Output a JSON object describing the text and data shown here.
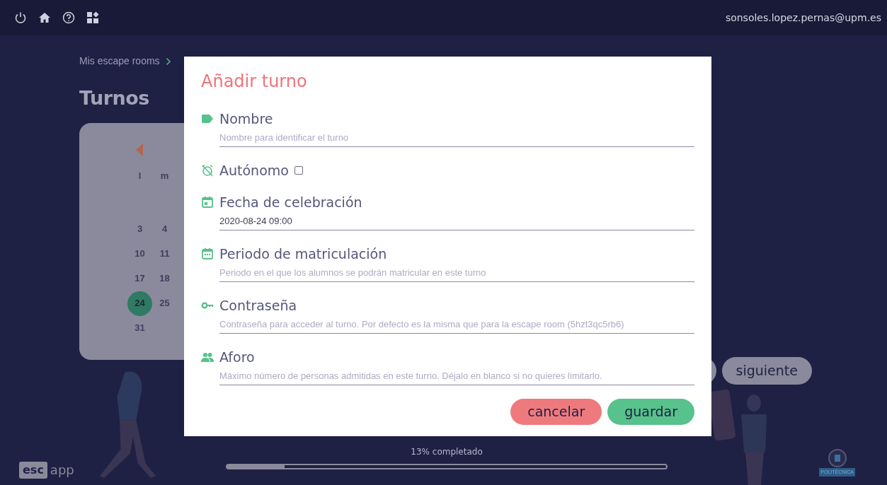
{
  "top_bar": {
    "user_email": "sonsoles.lopez.pernas@upm.es"
  },
  "breadcrumb": [
    {
      "label": "Mis escape rooms"
    }
  ],
  "page_title": "Turnos",
  "calendar": {
    "weekdays": [
      "l",
      "m"
    ],
    "weeks": [
      [
        {
          "day": "3",
          "selected": false
        },
        {
          "day": "4",
          "selected": false
        }
      ],
      [
        {
          "day": "10",
          "selected": false
        },
        {
          "day": "11",
          "selected": false
        }
      ],
      [
        {
          "day": "17",
          "selected": false
        },
        {
          "day": "18",
          "selected": false
        }
      ],
      [
        {
          "day": "24",
          "selected": true
        },
        {
          "day": "25",
          "selected": false
        }
      ],
      [
        {
          "day": "31",
          "selected": false
        }
      ]
    ]
  },
  "modal": {
    "title": "Añadir turno",
    "fields": [
      {
        "kind": "text",
        "label": "Nombre",
        "placeholder": "Nombre para identificar el turno"
      },
      {
        "kind": "checkbox",
        "label": "Autónomo",
        "checked": false
      },
      {
        "kind": "text",
        "label": "Fecha de celebración",
        "value": "2020-08-24 09:00"
      },
      {
        "kind": "text",
        "label": "Periodo de matriculación",
        "placeholder": "Periodo en el que los alumnos se podrán matricular en este turno"
      },
      {
        "kind": "text",
        "label": "Contraseña",
        "placeholder": "Contraseña para acceder al turno. Por defecto es la misma que para la escape room (5hzt3qc5rb6)"
      },
      {
        "kind": "text",
        "label": "Aforo",
        "placeholder": "Máximo número de personas admitidas en este turno. Déjalo en blanco si no quieres limitarlo."
      }
    ],
    "buttons": [
      {
        "kind": "cancel",
        "label": "cancelar"
      },
      {
        "kind": "save",
        "label": "guardar"
      }
    ]
  },
  "wizard": {
    "next_button": "siguiente"
  },
  "progress": {
    "label": "13% completado",
    "level": 0.13
  },
  "footer": {
    "logo": [
      "esc",
      "app"
    ],
    "university": "POLITÉCNICA"
  }
}
